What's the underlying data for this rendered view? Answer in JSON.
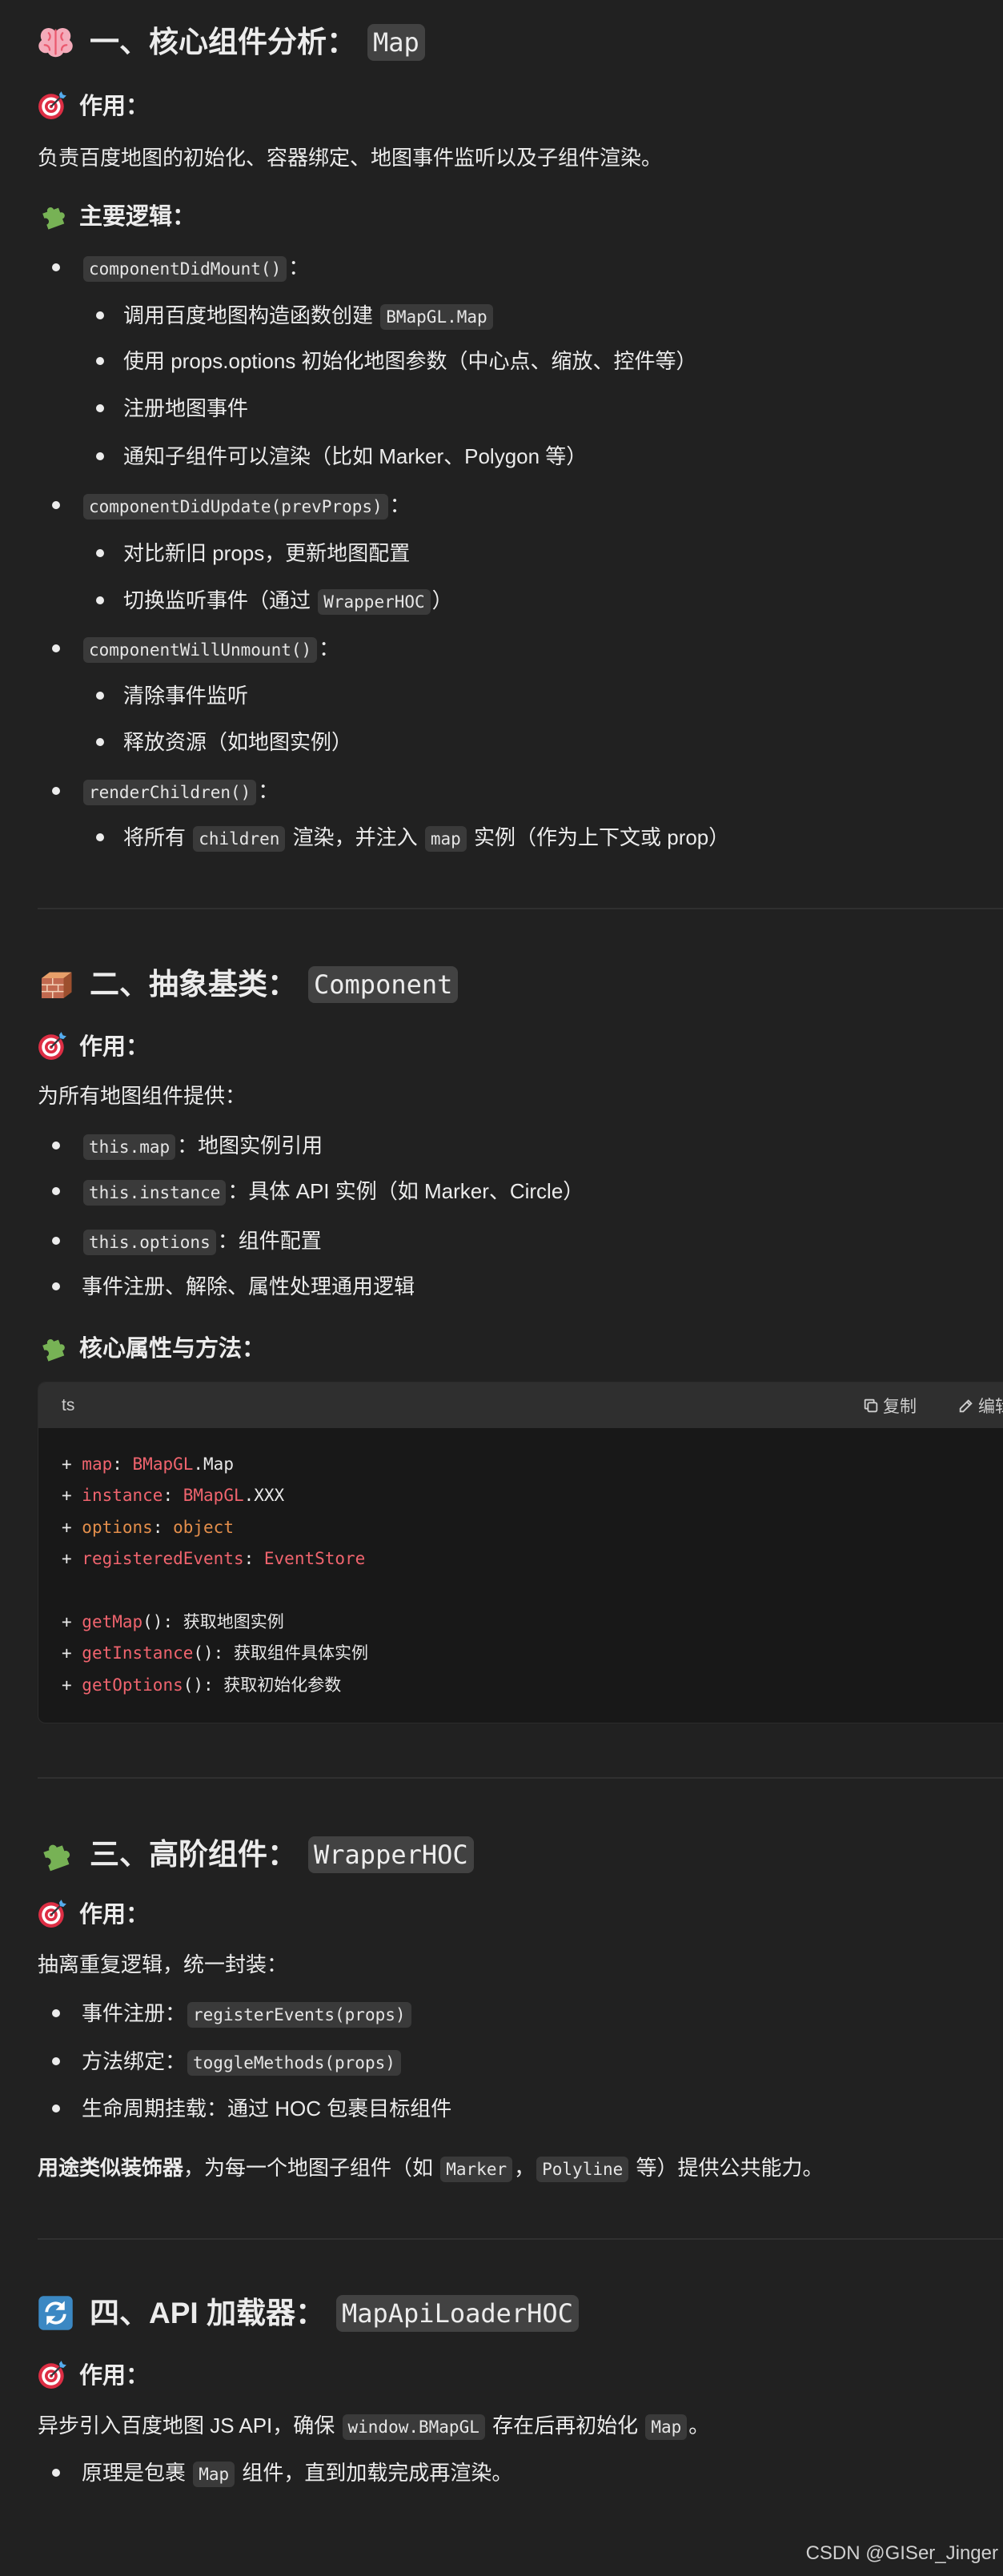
{
  "colors": {
    "background": "#212121",
    "text": "#ececec",
    "inline_code_bg": "#3a3a3a",
    "heading_code_bg": "#424242",
    "code_block_bg": "#181818",
    "code_header_bg": "#2f2f2f",
    "divider": "#303030",
    "watermark": "#d0d0d0"
  },
  "s1": {
    "heading": {
      "icon": "brain-icon",
      "text": "一、核心组件分析：",
      "code": "Map"
    },
    "purpose": {
      "icon": "target-icon",
      "title": "作用：",
      "text": "负责百度地图的初始化、容器绑定、地图事件监听以及子组件渲染。"
    },
    "logic": {
      "icon": "puzzle-icon",
      "title": "主要逻辑：",
      "items": [
        {
          "code": "componentDidMount()",
          "suffix": "：",
          "sub": [
            {
              "text": "调用百度地图构造函数创建 ",
              "code": "BMapGL.Map"
            },
            {
              "text": "使用 props.options 初始化地图参数（中心点、缩放、控件等）"
            },
            {
              "text": "注册地图事件"
            },
            {
              "text": "通知子组件可以渲染（比如 Marker、Polygon 等）"
            }
          ]
        },
        {
          "code": "componentDidUpdate(prevProps)",
          "suffix": "：",
          "sub": [
            {
              "text": "对比新旧 props，更新地图配置"
            },
            {
              "text": "切换监听事件（通过 ",
              "code": "WrapperHOC",
              "text2": "）"
            }
          ]
        },
        {
          "code": "componentWillUnmount()",
          "suffix": "：",
          "sub": [
            {
              "text": "清除事件监听"
            },
            {
              "text": "释放资源（如地图实例）"
            }
          ]
        },
        {
          "code": "renderChildren()",
          "suffix": "：",
          "sub": [
            {
              "text": "将所有 ",
              "code": "children",
              "text2": " 渲染，并注入 ",
              "code2": "map",
              "text3": " 实例（作为上下文或 prop）"
            }
          ]
        }
      ]
    }
  },
  "s2": {
    "heading": {
      "icon": "bricks-icon",
      "text": "二、抽象基类：",
      "code": "Component"
    },
    "purpose": {
      "icon": "target-icon",
      "title": "作用：",
      "text": "为所有地图组件提供："
    },
    "provides": [
      {
        "code": "this.map",
        "text": "：地图实例引用"
      },
      {
        "code": "this.instance",
        "text": "：具体 API 实例（如 Marker、Circle）"
      },
      {
        "code": "this.options",
        "text": "：组件配置"
      },
      {
        "text": "事件注册、解除、属性处理通用逻辑"
      }
    ],
    "members": {
      "icon": "puzzle-icon",
      "title": "核心属性与方法："
    },
    "code_block": {
      "language": "ts",
      "copy_label": "复制",
      "edit_label": "编辑",
      "lines": [
        [
          {
            "t": "+ "
          },
          {
            "t": "map",
            "color": "#f0646e"
          },
          {
            "t": ": "
          },
          {
            "t": "BMapGL",
            "color": "#f0646e"
          },
          {
            "t": ".Map"
          }
        ],
        [
          {
            "t": "+ "
          },
          {
            "t": "instance",
            "color": "#f0646e"
          },
          {
            "t": ": "
          },
          {
            "t": "BMapGL",
            "color": "#f0646e"
          },
          {
            "t": ".XXX"
          }
        ],
        [
          {
            "t": "+ "
          },
          {
            "t": "options",
            "color": "#e38e4b"
          },
          {
            "t": ": "
          },
          {
            "t": "object",
            "color": "#e38e4b"
          }
        ],
        [
          {
            "t": "+ "
          },
          {
            "t": "registeredEvents",
            "color": "#f0646e"
          },
          {
            "t": ": "
          },
          {
            "t": "EventStore",
            "color": "#f0646e"
          }
        ],
        [],
        [
          {
            "t": "+ "
          },
          {
            "t": "getMap",
            "color": "#f0646e"
          },
          {
            "t": "(): 获取地图实例"
          }
        ],
        [
          {
            "t": "+ "
          },
          {
            "t": "getInstance",
            "color": "#f0646e"
          },
          {
            "t": "(): 获取组件具体实例"
          }
        ],
        [
          {
            "t": "+ "
          },
          {
            "t": "getOptions",
            "color": "#f0646e"
          },
          {
            "t": "(): 获取初始化参数"
          }
        ]
      ]
    }
  },
  "s3": {
    "heading": {
      "icon": "puzzle-icon",
      "text": "三、高阶组件：",
      "code": "WrapperHOC"
    },
    "purpose": {
      "icon": "target-icon",
      "title": "作用：",
      "text": "抽离重复逻辑，统一封装："
    },
    "items": [
      {
        "text": "事件注册：",
        "code": "registerEvents(props)"
      },
      {
        "text": "方法绑定：",
        "code": "toggleMethods(props)"
      },
      {
        "text": "生命周期挂载：通过 HOC 包裹目标组件"
      }
    ],
    "note": {
      "bold": "用途类似装饰器",
      "text": "，为每一个地图子组件（如 ",
      "code": "Marker",
      "text2": "，",
      "code2": "Polyline",
      "text3": " 等）提供公共能力。"
    }
  },
  "s4": {
    "heading": {
      "icon": "refresh-icon",
      "text": "四、API 加载器：",
      "code": "MapApiLoaderHOC"
    },
    "purpose": {
      "icon": "target-icon",
      "title": "作用：",
      "text": "异步引入百度地图 JS API，确保 ",
      "code": "window.BMapGL",
      "text2": " 存在后再初始化 ",
      "code2": "Map",
      "text3": "。"
    },
    "items": [
      {
        "text": "原理是包裹 ",
        "code": "Map",
        "text2": " 组件，直到加载完成再渲染。"
      }
    ]
  },
  "watermark": "CSDN @GISer_Jinger"
}
